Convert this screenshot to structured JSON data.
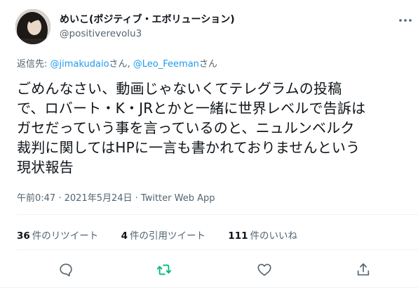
{
  "user": {
    "display_name": "めいこ(ポジティブ・エボリューション)",
    "handle": "@positiverevolu3"
  },
  "reply": {
    "prefix": "返信先: ",
    "mention1": "@jimakudaio",
    "suffix1": "さん, ",
    "mention2": "@Leo_Feeman",
    "suffix2": "さん"
  },
  "tweet": {
    "lines": [
      "ごめんなさい、動画じゃないくてテレグラムの投稿",
      "で、ロバート・K・JRとかと一緒に世界レベルで告訴は",
      "ガセだっていう事を言っているのと、ニュルンベルク",
      "裁判に関してはHPに一言も書かれておりませんという",
      "現状報告"
    ]
  },
  "meta": {
    "time": "午前0:47",
    "sep1": " · ",
    "date": "2021年5月24日",
    "sep2": " · ",
    "source": "Twitter Web App"
  },
  "stats": {
    "retweets_count": "36",
    "retweets_label": "件のリツイート",
    "quotes_count": "4",
    "quotes_label": "件の引用ツイート",
    "likes_count": "111",
    "likes_label": "件のいいね"
  },
  "icons": {
    "more": "more-horizontal-icon",
    "reply": "reply-bubble-icon",
    "retweet": "retweet-icon",
    "like": "heart-icon",
    "share": "share-icon"
  },
  "colors": {
    "text": "#0f1419",
    "secondary": "#536471",
    "link": "#1d9bf0",
    "retweet_active": "#00ba7c"
  }
}
